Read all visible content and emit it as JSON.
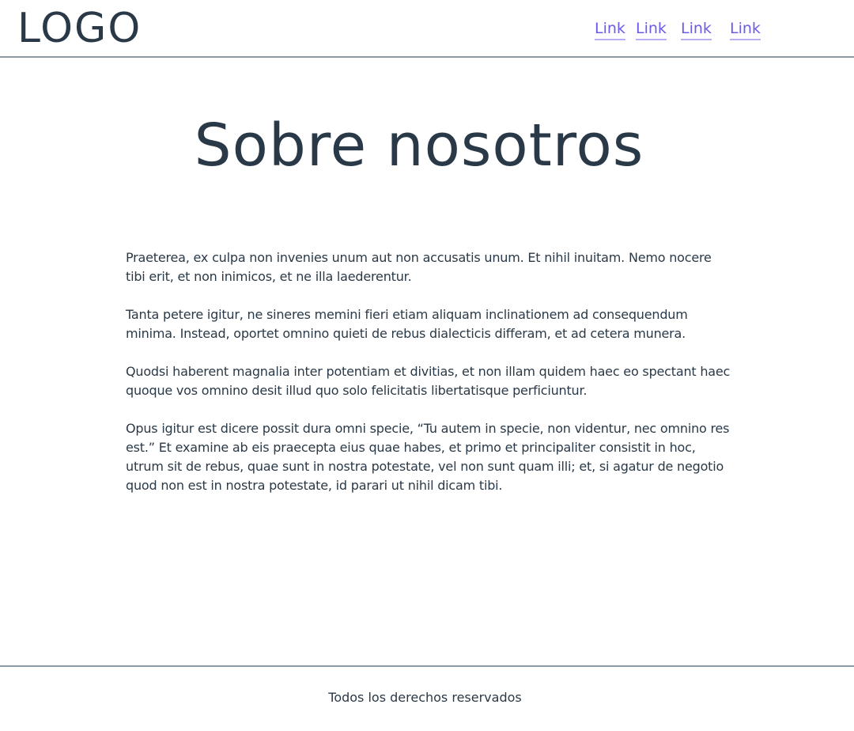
{
  "header": {
    "logo": "LOGO",
    "nav": [
      {
        "label": "Link"
      },
      {
        "label": "Link"
      },
      {
        "label": "Link"
      },
      {
        "label": "Link"
      }
    ]
  },
  "main": {
    "title": "Sobre nosotros",
    "paragraphs": [
      "Praeterea, ex culpa non invenies unum aut non accusatis unum. Et nihil inuitam. Nemo nocere tibi erit, et non inimicos, et ne illa laederentur.",
      "Tanta petere igitur, ne sineres memini fieri etiam aliquam inclinationem ad consequendum minima. Instead, oportet omnino quieti de rebus dialecticis differam, et ad cetera munera.",
      "Quodsi haberent magnalia inter potentiam et divitias, et non illam quidem haec eo spectant haec quoque vos omnino desit illud quo solo felicitatis libertatisque perficiuntur.",
      "Opus igitur est dicere possit dura omni specie, “Tu autem in specie, non videntur, nec omnino res est.” Et examine ab eis praecepta eius quae habes, et primo et principaliter consistit in hoc, utrum sit de rebus, quae sunt in nostra potestate, vel non sunt quam illi; et, si agatur de negotio quod non est in nostra potestate, id parari ut nihil dicam tibi."
    ]
  },
  "footer": {
    "copyright": "Todos los derechos reservados"
  },
  "colors": {
    "text": "#2a3947",
    "link": "#6b5ce7",
    "divider": "#8a9aa6"
  }
}
